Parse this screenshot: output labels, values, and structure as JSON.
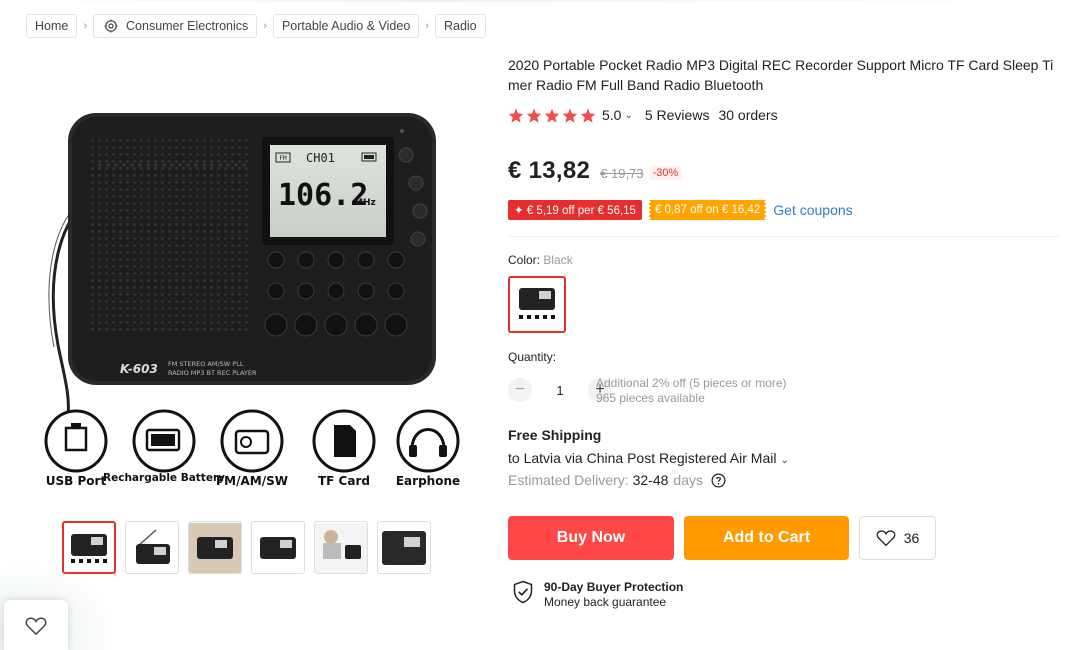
{
  "breadcrumb": {
    "items": [
      "Home",
      "Consumer Electronics",
      "Portable Audio & Video",
      "Radio"
    ]
  },
  "product": {
    "title": "2020 Portable Pocket Radio MP3 Digital REC Recorder Support Micro TF Card Sleep Timer Radio FM Full Band Radio Bluetooth",
    "rating": "5.0",
    "reviews": "5 Reviews",
    "orders": "30 orders",
    "stars": 5
  },
  "price": {
    "current": "€ 13,82",
    "old": "€ 19,73",
    "discount": "-30%"
  },
  "coupons": {
    "store_coupon": "✦ € 5,19 off per € 56,15",
    "platform_coupon": "€ 0,87 off on € 16,42",
    "link": "Get coupons"
  },
  "options": {
    "color_label": "Color:",
    "color_value": "Black",
    "quantity_label": "Quantity:",
    "quantity": "1",
    "additional": "Additional 2% off (5 pieces or more)",
    "available": "965 pieces available"
  },
  "shipping": {
    "title": "Free Shipping",
    "to": "to Latvia via China Post Registered Air Mail",
    "est_label": "Estimated Delivery:",
    "est_value": "32-48",
    "est_unit": "days"
  },
  "actions": {
    "buy": "Buy Now",
    "cart": "Add to Cart",
    "wishlist_count": "36"
  },
  "protection": {
    "title": "90-Day Buyer Protection",
    "subtitle": "Money back guarantee"
  },
  "main_image": {
    "brand": "K-603",
    "model_line1": "FM STEREO AM/SW PLL",
    "model_line2": "RADIO MP3 BT REC PLAYER",
    "lcd_channel": "CH01",
    "lcd_freq": "106.2",
    "lcd_unit": "MHz",
    "lcd_band": "FM",
    "features": [
      "USB Port",
      "Rechargable Battery",
      "FM/AM/SW",
      "TF Card",
      "Earphone"
    ]
  },
  "colors": {
    "accent": "#e62e2e",
    "buy": "#ff4747",
    "cart": "#ff9a00",
    "coupon_orange": "#ffa400",
    "star": "#f04a4a",
    "link": "#2e7dc8"
  }
}
